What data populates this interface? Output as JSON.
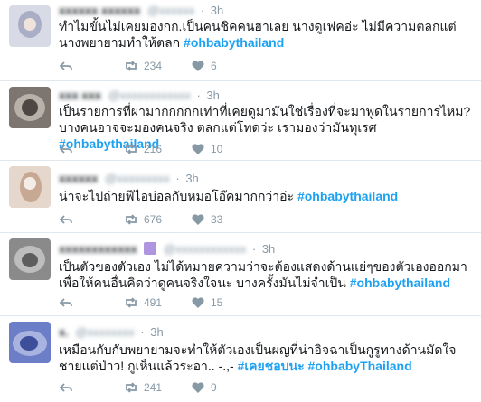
{
  "tweets": [
    {
      "time": "3h",
      "text_before": "ทำไมขั้นไม่เคยมองกก.เป็นคนชิคคนฮาเลย นางดูเฟคอ่ะ ไม่มีความตลกแต่นางพยายามทำให้ตลก ",
      "hashtag": "#ohbabythailand",
      "retweets": "234",
      "likes": "6",
      "avatar_colors": [
        "#d8dbe6",
        "#a9aec6",
        "#f0e3dc"
      ]
    },
    {
      "time": "3h",
      "text_before": "เป็นรายการที่ผ่ามากกกกกเท่าที่เคยดูมามันใช่เรื่องที่จะมาพูดในรายการไหม? บางคนอาจจะมองคนจริง ตลกแต่โทดว่ะ เรามองว่ามันทุเรศ ",
      "hashtag": "#ohbabythailand",
      "retweets": "216",
      "likes": "10",
      "avatar_colors": [
        "#7d756f",
        "#b7b1a9",
        "#4d4744"
      ]
    },
    {
      "time": "3h",
      "text_before": "น่าจะไปถ่ายฟีไอบ่อลกับหมอโอ๊คมากกว่าอ่ะ ",
      "hashtag": "#ohbabythailand",
      "retweets": "676",
      "likes": "33",
      "avatar_colors": [
        "#e6d7cd",
        "#c7a892",
        "#f3ece7"
      ]
    },
    {
      "time": "3h",
      "text_before": "เป็นตัวของตัวเอง ไม่ได้หมายความว่าจะต้องแสดงด้านแย่ๆของตัวเองออกมาเพื่อให้คนอื่นคิดว่าดูคนจริงใจนะ บางครั้งมันไม่จำเป็น ",
      "hashtag": "#ohbabythailand",
      "retweets": "491",
      "likes": "15",
      "avatar_colors": [
        "#8a8a8a",
        "#bdbdbd",
        "#5d5d5d"
      ]
    },
    {
      "time": "3h",
      "text_before": "เหมือนกับกับพยายามจะทำให้ตัวเองเป็นผญที่น่าอิจฉาเป็นกูรูทางด้านมัดใจชายแต่ป่าว! กูเห็นแล้วระอา.. -.,- ",
      "hashtag_extra": "#เคยชอบนะ",
      "hashtag": "#ohbabyThailand",
      "retweets": "241",
      "likes": "9",
      "avatar_colors": [
        "#6c7ec7",
        "#a8b3e0",
        "#3d4f9a"
      ]
    }
  ]
}
